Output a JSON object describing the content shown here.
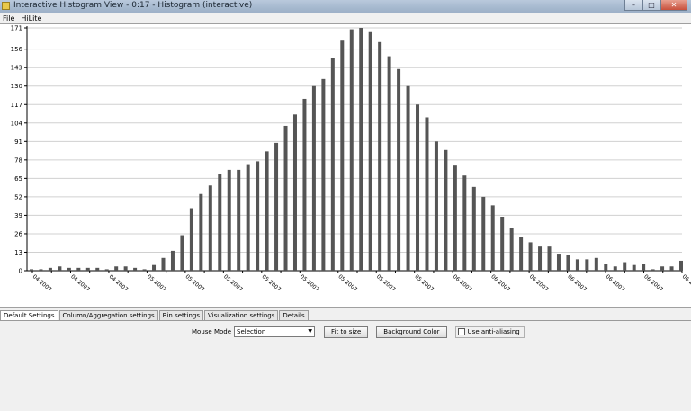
{
  "window": {
    "title": "Interactive Histogram View - 0:17 - Histogram (interactive)",
    "controls": {
      "minimize": "–",
      "maximize": "□",
      "close": "✕"
    }
  },
  "menu": [
    "File",
    "HiLite"
  ],
  "chart_data": {
    "type": "bar",
    "ylim": [
      0,
      171
    ],
    "y_ticks": [
      0,
      13,
      26,
      39,
      52,
      65,
      78,
      91,
      104,
      117,
      130,
      143,
      156,
      171
    ],
    "grid": true,
    "values": [
      1,
      1,
      2,
      3,
      2,
      2,
      2,
      2,
      1,
      3,
      3,
      2,
      1,
      4,
      9,
      14,
      25,
      44,
      54,
      60,
      68,
      71,
      71,
      75,
      77,
      84,
      90,
      102,
      110,
      121,
      130,
      135,
      150,
      162,
      170,
      171,
      168,
      161,
      151,
      142,
      130,
      117,
      108,
      91,
      85,
      74,
      67,
      59,
      52,
      46,
      38,
      30,
      24,
      20,
      17,
      17,
      12,
      11,
      8,
      8,
      9,
      5,
      3,
      6,
      4,
      5,
      1,
      3,
      3,
      7
    ],
    "x_tick_labels": [
      "04-2007",
      "",
      "04-2007",
      "",
      "04-2007",
      "",
      "05-2007",
      "",
      "05-2007",
      "",
      "05-2007",
      "",
      "05-2007",
      "",
      "05-2007",
      "",
      "05-2007",
      "",
      "05-2007",
      "",
      "05-2007",
      "",
      "06-2007",
      "",
      "06-2007",
      "",
      "06-2007",
      "",
      "06-2007",
      "",
      "06-2007",
      "",
      "06-2007",
      "",
      "06-2"
    ],
    "bar_color": "#555555"
  },
  "tabs": [
    {
      "label": "Default Settings",
      "active": true
    },
    {
      "label": "Column/Aggregation settings",
      "active": false
    },
    {
      "label": "Bin settings",
      "active": false
    },
    {
      "label": "Visualization settings",
      "active": false
    },
    {
      "label": "Details",
      "active": false
    }
  ],
  "settings": {
    "mouse_mode_label": "Mouse Mode",
    "mouse_mode_value": "Selection",
    "dropdown_arrow": "▼",
    "fit_button": "Fit to size",
    "bg_button": "Background Color",
    "antialias_label": "Use anti-aliasing",
    "antialias_checked": false
  }
}
